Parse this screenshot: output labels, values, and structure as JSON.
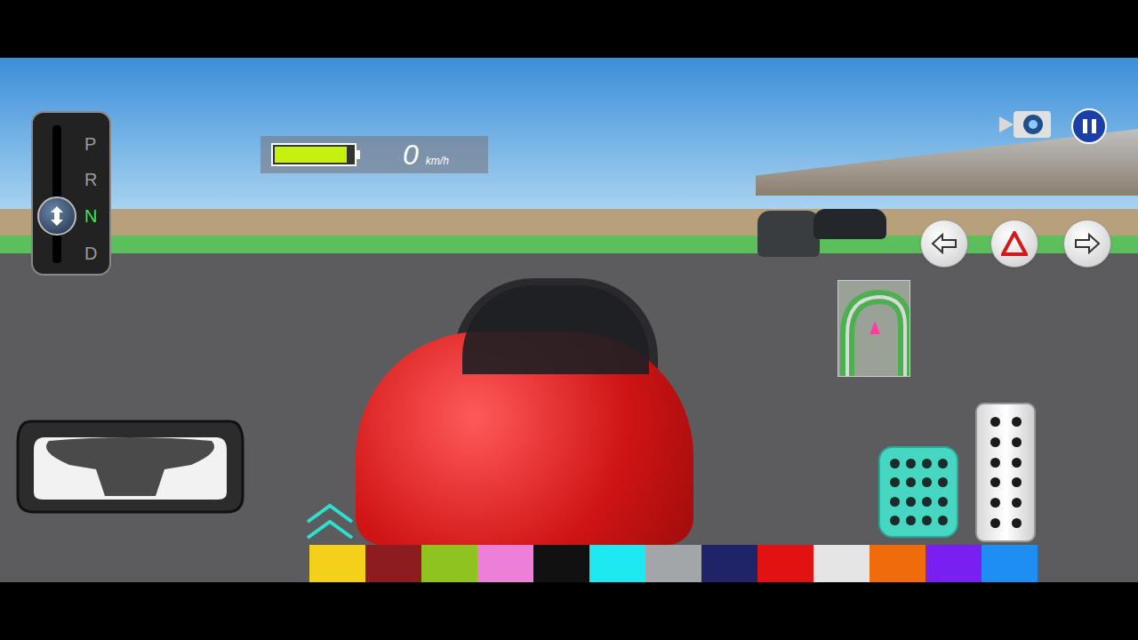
{
  "gear_selector": {
    "gears": [
      {
        "label": "P",
        "selected": false
      },
      {
        "label": "R",
        "selected": false
      },
      {
        "label": "N",
        "selected": true
      },
      {
        "label": "D",
        "selected": false
      }
    ]
  },
  "hud": {
    "battery": {
      "level": 0.92
    },
    "speed": "0",
    "unit": "km/h"
  },
  "color_palette": {
    "swatches": [
      {
        "color": "#f5d01a"
      },
      {
        "color": "#8c1c1f"
      },
      {
        "color": "#8fc320"
      },
      {
        "color": "#ee7fd8"
      },
      {
        "color": "#111111"
      },
      {
        "color": "#1ee8f2"
      },
      {
        "color": "#a3a6a9"
      },
      {
        "color": "#1f2468"
      },
      {
        "color": "#e11212"
      },
      {
        "color": "#e5e5e5"
      },
      {
        "color": "#f06b0c"
      },
      {
        "color": "#7a1ff2"
      },
      {
        "color": "#1f8ef2"
      }
    ]
  }
}
